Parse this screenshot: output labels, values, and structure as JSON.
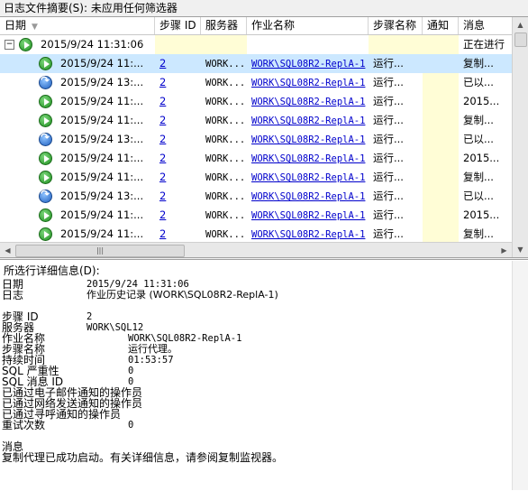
{
  "filter_bar": {
    "label": "日志文件摘要(S):",
    "value": "未应用任何筛选器"
  },
  "columns": [
    "日期",
    "步骤 ID",
    "服务器",
    "作业名称",
    "步骤名称",
    "通知",
    "消息"
  ],
  "rows": [
    {
      "type": "parent",
      "icon": "success-icon",
      "date": "2015/9/24 11:31:06",
      "step_id": "",
      "server": "",
      "job": "",
      "step_name": "",
      "notify": "",
      "message": "正在进行"
    },
    {
      "type": "child",
      "icon": "success-icon",
      "date": "2015/9/24 11:...",
      "step_id": "2",
      "server": "WORK...",
      "job": "WORK\\SQL08R2-ReplA-1",
      "step_name": "运行...",
      "notify": "",
      "message": "复制...",
      "selected": true
    },
    {
      "type": "child",
      "icon": "retry-icon",
      "date": "2015/9/24 13:...",
      "step_id": "2",
      "server": "WORK...",
      "job": "WORK\\SQL08R2-ReplA-1",
      "step_name": "运行...",
      "notify": "",
      "message": "已以..."
    },
    {
      "type": "child",
      "icon": "success-icon",
      "date": "2015/9/24 11:...",
      "step_id": "2",
      "server": "WORK...",
      "job": "WORK\\SQL08R2-ReplA-1",
      "step_name": "运行...",
      "notify": "",
      "message": "2015..."
    },
    {
      "type": "child",
      "icon": "success-icon",
      "date": "2015/9/24 11:...",
      "step_id": "2",
      "server": "WORK...",
      "job": "WORK\\SQL08R2-ReplA-1",
      "step_name": "运行...",
      "notify": "",
      "message": "复制..."
    },
    {
      "type": "child",
      "icon": "retry-icon",
      "date": "2015/9/24 13:...",
      "step_id": "2",
      "server": "WORK...",
      "job": "WORK\\SQL08R2-ReplA-1",
      "step_name": "运行...",
      "notify": "",
      "message": "已以..."
    },
    {
      "type": "child",
      "icon": "success-icon",
      "date": "2015/9/24 11:...",
      "step_id": "2",
      "server": "WORK...",
      "job": "WORK\\SQL08R2-ReplA-1",
      "step_name": "运行...",
      "notify": "",
      "message": "2015..."
    },
    {
      "type": "child",
      "icon": "success-icon",
      "date": "2015/9/24 11:...",
      "step_id": "2",
      "server": "WORK...",
      "job": "WORK\\SQL08R2-ReplA-1",
      "step_name": "运行...",
      "notify": "",
      "message": "复制..."
    },
    {
      "type": "child",
      "icon": "retry-icon",
      "date": "2015/9/24 13:...",
      "step_id": "2",
      "server": "WORK...",
      "job": "WORK\\SQL08R2-ReplA-1",
      "step_name": "运行...",
      "notify": "",
      "message": "已以..."
    },
    {
      "type": "child",
      "icon": "success-icon",
      "date": "2015/9/24 11:...",
      "step_id": "2",
      "server": "WORK...",
      "job": "WORK\\SQL08R2-ReplA-1",
      "step_name": "运行...",
      "notify": "",
      "message": "2015..."
    },
    {
      "type": "child",
      "icon": "success-icon",
      "date": "2015/9/24 11:...",
      "step_id": "2",
      "server": "WORK...",
      "job": "WORK\\SQL08R2-ReplA-1",
      "step_name": "运行...",
      "notify": "",
      "message": "复制..."
    }
  ],
  "hscroll_thumb_label": "|||",
  "details": {
    "title": "所选行详细信息(D):",
    "fields": [
      {
        "label": "日期",
        "value": "2015/9/24 11:31:06"
      },
      {
        "label": "日志",
        "value": "作业历史记录 (WORK\\SQL08R2-ReplA-1)"
      },
      {
        "label": "步骤 ID",
        "value": "2"
      },
      {
        "label": "服务器",
        "value": "WORK\\SQL12"
      },
      {
        "label": "作业名称",
        "value": "WORK\\SQL08R2-ReplA-1"
      },
      {
        "label": "步骤名称",
        "value": "运行代理。"
      },
      {
        "label": "持续时间",
        "value": "01:53:57"
      },
      {
        "label": "SQL 严重性",
        "value": "0"
      },
      {
        "label": "SQL 消息 ID",
        "value": "0"
      },
      {
        "label": "已通过电子邮件通知的操作员",
        "value": ""
      },
      {
        "label": "已通过网络发送通知的操作员",
        "value": ""
      },
      {
        "label": "已通过寻呼通知的操作员",
        "value": ""
      },
      {
        "label": "重试次数",
        "value": "0"
      }
    ],
    "message_label": "消息",
    "message_text": "复制代理已成功启动。有关详细信息，请参阅复制监视器。"
  }
}
